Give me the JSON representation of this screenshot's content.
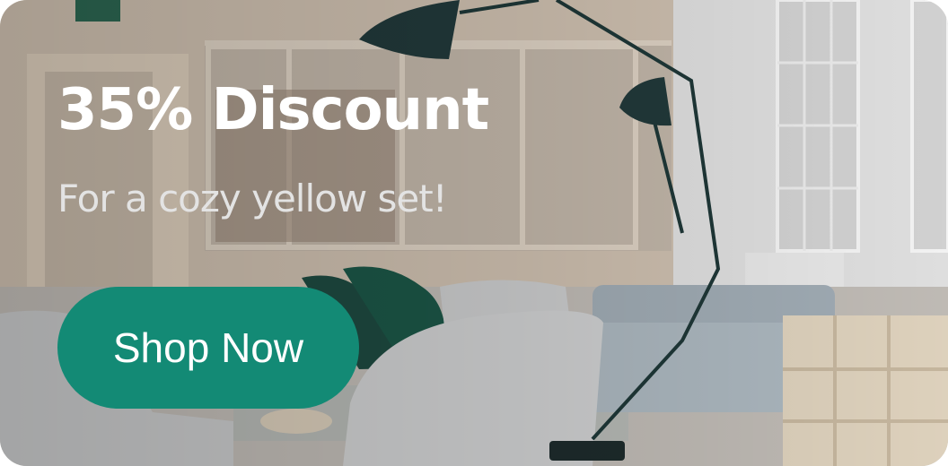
{
  "promo": {
    "headline": "35% Discount",
    "subline": "For a cozy yellow set!",
    "cta_label": "Shop Now"
  },
  "colors": {
    "cta_background": "#138a75",
    "headline_text": "#ffffff",
    "subline_text": "#e3e3e3"
  },
  "icons": {
    "exit_sign": "emergency-exit-sign-icon"
  }
}
